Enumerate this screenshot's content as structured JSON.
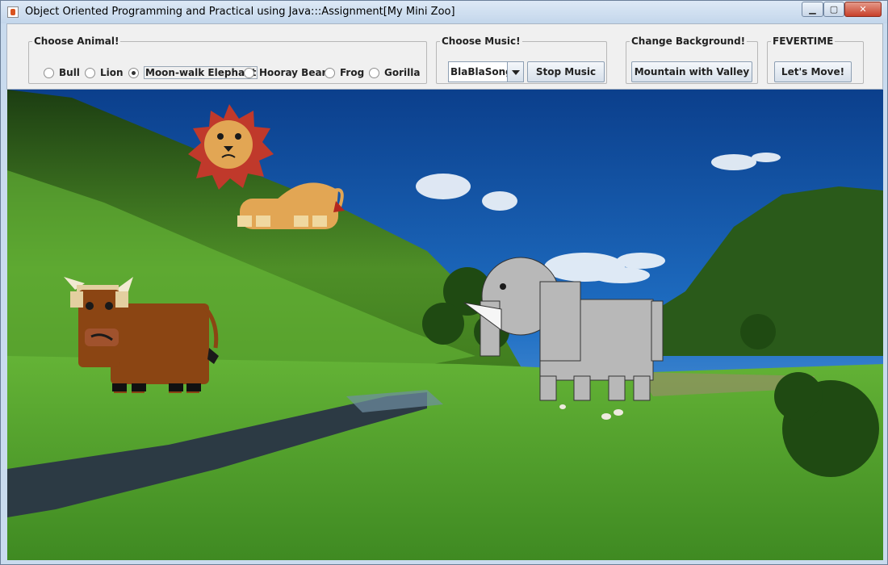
{
  "window": {
    "title": "Object Oriented Programming and Practical using Java:::Assignment[My Mini Zoo]",
    "controls": {
      "minimize": "▁",
      "maximize": "▢",
      "close": "✕"
    }
  },
  "choose_animal": {
    "legend": "Choose Animal!",
    "options": [
      "Bull",
      "Lion",
      "Moon-walk Elephant",
      "Hooray Bear",
      "Frog",
      "Gorilla"
    ],
    "selected": "Moon-walk Elephant"
  },
  "choose_music": {
    "legend": "Choose Music!",
    "selected_song": "BlaBlaSong",
    "stop_label": "Stop Music"
  },
  "change_background": {
    "legend": "Change Background!",
    "button_label": "Mountain with Valley"
  },
  "fevertime": {
    "legend": "FEVERTIME",
    "button_label": "Let's Move!"
  },
  "scene": {
    "background": "mountain-with-valley",
    "animals": [
      "lion",
      "bull",
      "elephant"
    ],
    "colors": {
      "sky": "#1a63b8",
      "grass": "#5aa832",
      "river": "#2c3a44",
      "lion": "#e2a654",
      "mane": "#c0392b",
      "bull": "#8b4513",
      "elephant": "#b8b8b8"
    }
  }
}
